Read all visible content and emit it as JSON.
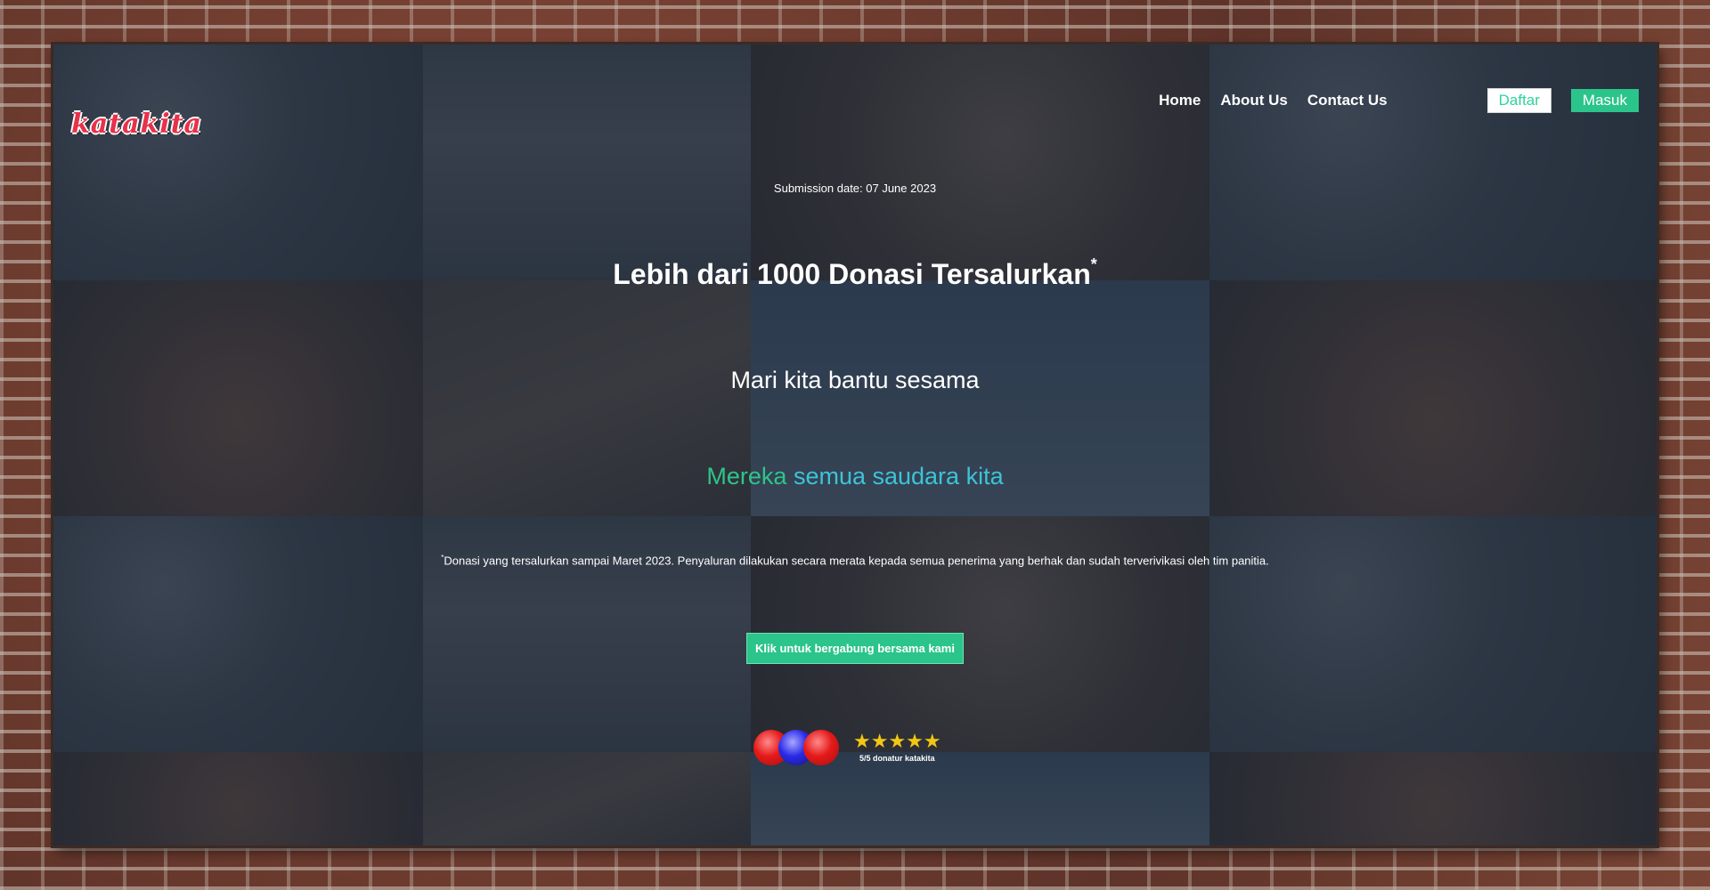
{
  "brand": {
    "logo_text": "katakita"
  },
  "nav": {
    "links": [
      {
        "label": "Home"
      },
      {
        "label": "About Us"
      },
      {
        "label": "Contact Us"
      }
    ],
    "daftar_label": "Daftar",
    "masuk_label": "Masuk"
  },
  "hero": {
    "submission_date": "Submission date: 07 June 2023",
    "headline": "Lebih dari 1000 Donasi Tersalurkan",
    "headline_mark": "*",
    "subtitle": "Mari kita bantu sesama",
    "tagline_part1": "Mereka",
    "tagline_part2": "semua saudara kita",
    "footnote_mark": "*",
    "footnote": "Donasi yang tersalurkan sampai Maret 2023. Penyaluran dilakukan secara merata kepada semua penerima yang berhak dan sudah terverivikasi oleh tim panitia.",
    "cta_label": "Klik untuk bergabung bersama kami"
  },
  "rating": {
    "stars": "★★★★★",
    "stars_value": 5,
    "stars_max": 5,
    "text": "5/5 donatur katakita"
  },
  "colors": {
    "accent_green": "#2bc48a",
    "accent_cyan": "#3ec3d6",
    "logo_red": "#e8314a",
    "star_yellow": "#f2c613"
  }
}
